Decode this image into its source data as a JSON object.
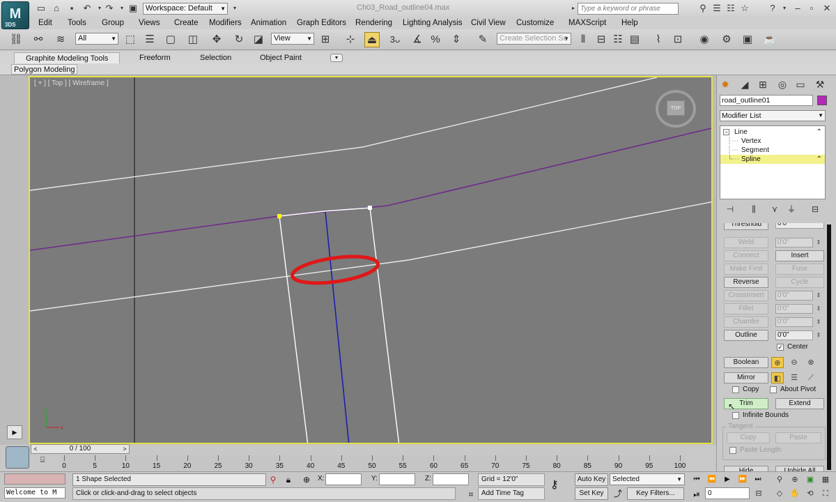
{
  "app": {
    "logo_text": "3DS",
    "document_title": "Ch03_Road_outline04.max"
  },
  "workspace": {
    "label": "Workspace: Default"
  },
  "search": {
    "placeholder": "Type a keyword or phrase"
  },
  "menus": [
    "Edit",
    "Tools",
    "Group",
    "Views",
    "Create",
    "Modifiers",
    "Animation",
    "Graph Editors",
    "Rendering",
    "Lighting Analysis",
    "Civil View",
    "Customize",
    "MAXScript",
    "Help"
  ],
  "toolbar": {
    "selection_filter": "All",
    "reference_coord": "View",
    "snap_label": "3",
    "selection_set_placeholder": "Create Selection Se"
  },
  "ribbon": {
    "tabs": [
      "Graphite Modeling Tools",
      "Freeform",
      "Selection",
      "Object Paint"
    ],
    "active_panel": "Polygon Modeling"
  },
  "viewport": {
    "label": "[ + ] [ Top ] [ Wireframe ]",
    "viewcube_face": "TOP",
    "border_color": "#e2e24a"
  },
  "command_panel": {
    "object_name": "road_outline01",
    "object_color": "#b32ab8",
    "modifier_list": "Modifier List",
    "stack": [
      {
        "label": "Line",
        "level": 0,
        "selected": false
      },
      {
        "label": "Vertex",
        "level": 1,
        "selected": false
      },
      {
        "label": "Segment",
        "level": 1,
        "selected": false
      },
      {
        "label": "Spline",
        "level": 1,
        "selected": true
      }
    ],
    "geometry": {
      "threshold_label": "Threshold",
      "threshold_value": "0'0\"",
      "weld": "Weld",
      "weld_value": "0'0\"",
      "connect": "Connect",
      "insert": "Insert",
      "make_first": "Make First",
      "fuse": "Fuse",
      "reverse": "Reverse",
      "cycle": "Cycle",
      "crossinsert": "CrossInsert",
      "crossinsert_value": "0'0\"",
      "fillet": "Fillet",
      "fillet_value": "0'0\"",
      "chamfer": "Chamfer",
      "chamfer_value": "0'0\"",
      "outline": "Outline",
      "outline_value": "0'0\"",
      "center": "Center",
      "boolean": "Boolean",
      "mirror": "Mirror",
      "copy": "Copy",
      "about_pivot": "About Pivot",
      "trim": "Trim",
      "extend": "Extend",
      "infinite_bounds": "Infinite Bounds",
      "tangent_group": "Tangent",
      "tangent_copy": "Copy",
      "tangent_paste": "Paste",
      "paste_length": "Paste Length",
      "hide": "Hide",
      "unhide_all": "Unhide All"
    }
  },
  "timeline": {
    "frame_display": "0 / 100",
    "ticks": [
      "0",
      "5",
      "10",
      "15",
      "20",
      "25",
      "30",
      "35",
      "40",
      "45",
      "50",
      "55",
      "60",
      "65",
      "70",
      "75",
      "80",
      "85",
      "90",
      "95",
      "100"
    ]
  },
  "status": {
    "script_output": "Welcome to M",
    "selection": "1 Shape Selected",
    "prompt": "Click or click-and-drag to select objects",
    "x_label": "X:",
    "y_label": "Y:",
    "z_label": "Z:",
    "grid": "Grid = 12'0\"",
    "add_time_tag": "Add Time Tag",
    "auto_key": "Auto Key",
    "set_key": "Set Key",
    "key_mode": "Selected",
    "key_filters": "Key Filters...",
    "current_frame": "0"
  }
}
